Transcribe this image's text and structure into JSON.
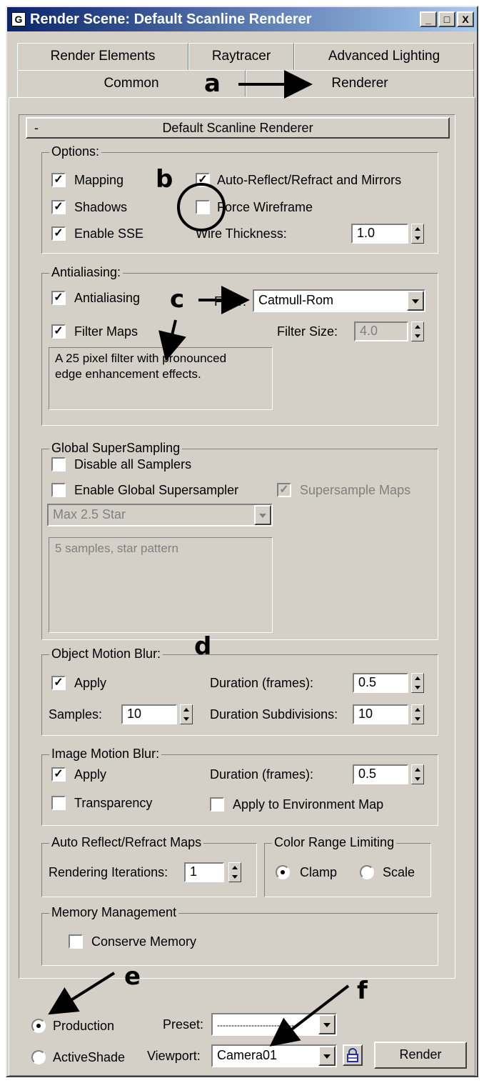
{
  "window": {
    "title": "Render Scene: Default Scanline Renderer",
    "app_icon": "G",
    "minimize_glyph": "_",
    "maximize_glyph": "□",
    "close_glyph": "X"
  },
  "tabs_row1": [
    "Render Elements",
    "Raytracer",
    "Advanced Lighting"
  ],
  "tabs_row2": [
    "Common",
    "Renderer"
  ],
  "rollout": {
    "collapse_glyph": "-",
    "title": "Default Scanline Renderer"
  },
  "options": {
    "title": "Options:",
    "mapping": {
      "label": "Mapping",
      "checked": true
    },
    "shadows": {
      "label": "Shadows",
      "checked": true
    },
    "enable_sse": {
      "label": "Enable SSE",
      "checked": true
    },
    "auto_reflect": {
      "label": "Auto-Reflect/Refract and Mirrors",
      "checked": true
    },
    "force_wireframe": {
      "label": "Force Wireframe",
      "checked": false
    },
    "wire_thickness": {
      "label": "Wire Thickness:",
      "value": "1.0"
    }
  },
  "antialiasing": {
    "title": "Antialiasing:",
    "antialiasing": {
      "label": "Antialiasing",
      "checked": true
    },
    "filter_maps": {
      "label": "Filter Maps",
      "checked": true
    },
    "filter_label": "Filter:",
    "filter_value": "Catmull-Rom",
    "filter_size_label": "Filter Size:",
    "filter_size_value": "4.0",
    "description": "A 25 pixel filter with pronounced\nedge enhancement effects."
  },
  "global_supersampling": {
    "title": "Global SuperSampling",
    "disable_all": {
      "label": "Disable all Samplers",
      "checked": false
    },
    "enable_global": {
      "label": "Enable Global Supersampler",
      "checked": false
    },
    "supersample_maps": {
      "label": "Supersample Maps",
      "checked": true
    },
    "sampler_value": "Max 2.5 Star",
    "description": "5 samples, star pattern"
  },
  "object_motion_blur": {
    "title": "Object Motion Blur:",
    "apply": {
      "label": "Apply",
      "checked": true
    },
    "duration_label": "Duration (frames):",
    "duration_value": "0.5",
    "samples_label": "Samples:",
    "samples_value": "10",
    "subdivisions_label": "Duration Subdivisions:",
    "subdivisions_value": "10"
  },
  "image_motion_blur": {
    "title": "Image Motion Blur:",
    "apply": {
      "label": "Apply",
      "checked": true
    },
    "transparency": {
      "label": "Transparency",
      "checked": false
    },
    "duration_label": "Duration (frames):",
    "duration_value": "0.5",
    "env_map": {
      "label": "Apply to Environment Map",
      "checked": false
    }
  },
  "auto_reflect_maps": {
    "title": "Auto Reflect/Refract Maps",
    "iterations_label": "Rendering Iterations:",
    "iterations_value": "1"
  },
  "color_range": {
    "title": "Color Range Limiting",
    "clamp": {
      "label": "Clamp",
      "selected": true
    },
    "scale": {
      "label": "Scale",
      "selected": false
    }
  },
  "memory": {
    "title": "Memory Management",
    "conserve": {
      "label": "Conserve Memory",
      "checked": false
    }
  },
  "bottom": {
    "production": {
      "label": "Production",
      "selected": true
    },
    "activeshade": {
      "label": "ActiveShade",
      "selected": false
    },
    "preset_label": "Preset:",
    "preset_value": "----------------------------",
    "viewport_label": "Viewport:",
    "viewport_value": "Camera01",
    "lock_icon": "lock-icon",
    "render_label": "Render"
  },
  "annotations": [
    "a",
    "b",
    "c",
    "d",
    "e",
    "f"
  ],
  "check_glyph": "✓"
}
